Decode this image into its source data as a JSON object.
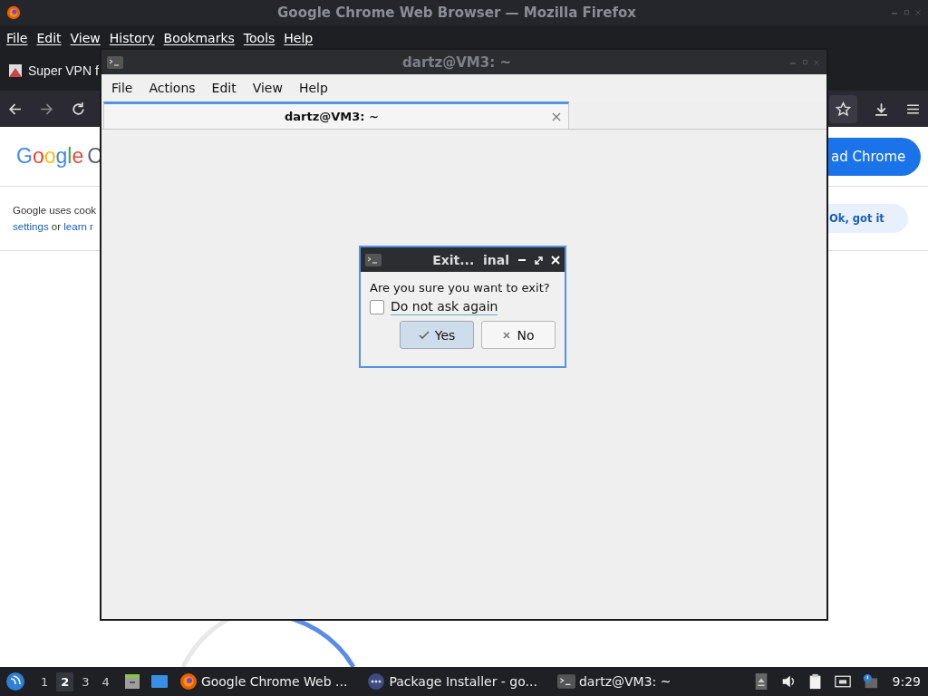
{
  "firefox": {
    "title": "Google Chrome Web Browser — Mozilla Firefox",
    "menu": [
      "File",
      "Edit",
      "View",
      "History",
      "Bookmarks",
      "Tools",
      "Help"
    ],
    "tab": {
      "label": "Super VPN f"
    },
    "page": {
      "logo": [
        {
          "char": "G",
          "color": "#4285f4"
        },
        {
          "char": "o",
          "color": "#ea4335"
        },
        {
          "char": "o",
          "color": "#fbbc05"
        },
        {
          "char": "g",
          "color": "#4285f4"
        },
        {
          "char": "l",
          "color": "#34a853"
        },
        {
          "char": "e",
          "color": "#ea4335"
        }
      ],
      "logo_cut": "C",
      "download_button": "ad Chrome",
      "cookie_text": "Google uses cook",
      "cookie_link_1": "settings",
      "cookie_or": "or",
      "cookie_link_2": "learn r",
      "ok_button": "Ok, got it"
    }
  },
  "terminal": {
    "title": "dartz@VM3: ~",
    "menu": [
      "File",
      "Actions",
      "Edit",
      "View",
      "Help"
    ],
    "tabs": [
      {
        "label": "dartz@VM3: ~",
        "selected": true
      }
    ]
  },
  "dialog": {
    "title": "Exit...  inal",
    "message": "Are you sure you want to exit?",
    "checkbox": {
      "label": "Do not ask again",
      "checked": false
    },
    "buttons": [
      {
        "label": "Yes",
        "kind": "yes",
        "selected": true
      },
      {
        "label": "No",
        "kind": "no",
        "selected": false
      }
    ]
  },
  "taskbar": {
    "workspaces": [
      {
        "label": "1",
        "selected": false
      },
      {
        "label": "2",
        "selected": true
      },
      {
        "label": "3",
        "selected": false
      },
      {
        "label": "4",
        "selected": false
      }
    ],
    "tasks": [
      {
        "label": "Google Chrome Web ...",
        "kind": "browser"
      },
      {
        "label": "Package Installer - go...",
        "kind": "installer"
      },
      {
        "label": "dartz@VM3: ~",
        "kind": "terminal"
      }
    ],
    "clock": "9:29"
  }
}
